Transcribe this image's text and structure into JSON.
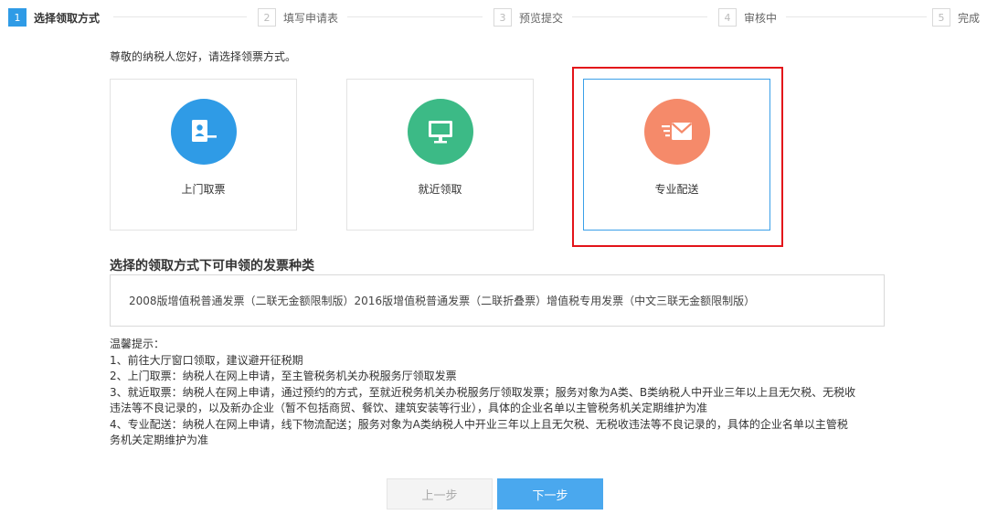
{
  "steps": [
    {
      "num": "1",
      "label": "选择领取方式",
      "active": true
    },
    {
      "num": "2",
      "label": "填写申请表",
      "active": false
    },
    {
      "num": "3",
      "label": "预览提交",
      "active": false
    },
    {
      "num": "4",
      "label": "审核中",
      "active": false
    },
    {
      "num": "5",
      "label": "完成",
      "active": false
    }
  ],
  "greeting": "尊敬的纳税人您好，请选择领票方式。",
  "options": [
    {
      "label": "上门取票",
      "icon": "user-card-icon",
      "color": "#2f9be6",
      "selected": false
    },
    {
      "label": "就近领取",
      "icon": "monitor-icon",
      "color": "#3cba86",
      "selected": false
    },
    {
      "label": "专业配送",
      "icon": "envelope-icon",
      "color": "#f58a6a",
      "selected": true
    }
  ],
  "invoice_section": {
    "title": "选择的领取方式下可申领的发票种类",
    "types_text": "2008版增值税普通发票（二联无金额限制版）2016版增值税普通发票（二联折叠票）增值税专用发票（中文三联无金额限制版）"
  },
  "tips": {
    "lines": [
      "温馨提示：",
      "1、前往大厅窗口领取，建议避开征税期",
      "2、上门取票：纳税人在网上申请，至主管税务机关办税服务厅领取发票",
      "3、就近取票：纳税人在网上申请，通过预约的方式，至就近税务机关办税服务厅领取发票；服务对象为A类、B类纳税人中开业三年以上且无欠税、无税收",
      "违法等不良记录的，以及新办企业（暂不包括商贸、餐饮、建筑安装等行业），具体的企业名单以主管税务机关定期维护为准",
      "4、专业配送：纳税人在网上申请，线下物流配送；服务对象为A类纳税人中开业三年以上且无欠税、无税收违法等不良记录的，具体的企业名单以主管税",
      "务机关定期维护为准"
    ]
  },
  "buttons": {
    "prev": "上一步",
    "next": "下一步"
  }
}
